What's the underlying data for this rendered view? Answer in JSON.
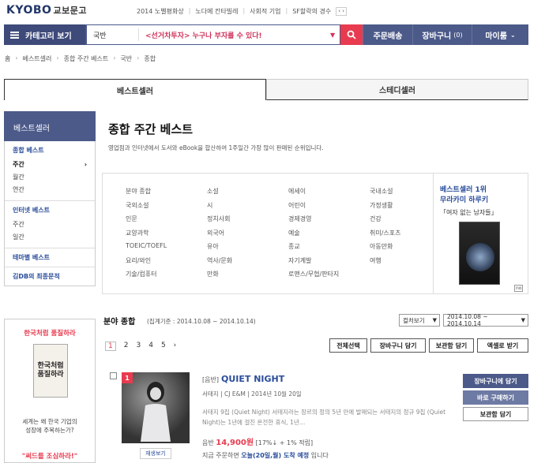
{
  "brand": {
    "logo_en": "KYOBO",
    "logo_kr": "교보문고"
  },
  "promo_links": [
    "2014 노벨평화상",
    "노다메 칸타빌레",
    "사회적 기업",
    "SF할락의 경수"
  ],
  "promo_arrows": "‹ ›",
  "nav": {
    "category_label": "카테고리 보기",
    "search_category": "국반",
    "search_placeholder": "<선거차투자> 누구나 부자를 수 있다!",
    "order_label": "주문배송",
    "cart_label": "장바구니",
    "cart_count": "(0)",
    "mypage_label": "마이룸"
  },
  "breadcrumb": [
    "홈",
    "베스트셀러",
    "종합 주간 베스트",
    "국반",
    "종합"
  ],
  "tabs": [
    "베스트셀러",
    "스테디셀러"
  ],
  "sidebar": {
    "head": "베스트셀러",
    "groups": [
      {
        "title": "종합 베스트",
        "items": [
          "주간",
          "월간",
          "연간"
        ]
      },
      {
        "title": "인터넷 베스트",
        "items": [
          "주간",
          "일간"
        ]
      },
      {
        "title": "테마별 베스트",
        "items": []
      },
      {
        "title": "김DB의 최종문적",
        "items": []
      }
    ]
  },
  "main": {
    "title": "종합 주간 베스트",
    "description": "영업점과 인터넷에서 도서와 eBook을 합산하여 1주일간 가장 많이 판매된 순위입니다.",
    "genres": [
      "분야 종합",
      "소설",
      "에세이",
      "국내소설",
      "국외소설",
      "시",
      "어린이",
      "가정생활",
      "인문",
      "정치사회",
      "경제경영",
      "건강",
      "교양과학",
      "외국어",
      "예술",
      "취미/스포츠",
      "TOEIC/TOEFL",
      "유아",
      "종교",
      "아동만화",
      "요리/와인",
      "역사/문화",
      "자기계발",
      "여행",
      "기술/컴퓨터",
      "만화",
      "로맨스/무협/판타지",
      ""
    ]
  },
  "banner": {
    "line1": "베스트셀러 1위",
    "line2": "무라카미 하루키",
    "line3": "「여자 없는 남자들」",
    "tag": "no"
  },
  "field": {
    "title": "분야 종합",
    "date": "(집계기준 : 2014.10.08 ~ 2014.10.14)",
    "sort": "컬처보기",
    "range": "2014.10.08 ~ 2014.10.14"
  },
  "pagination": [
    "1",
    "2",
    "3",
    "4",
    "5",
    "›"
  ],
  "actions": [
    "전체선택",
    "장바구니 담기",
    "보관함 담기",
    "엑셀로 받기"
  ],
  "product": {
    "rank": "1",
    "tag": "[음반]",
    "title": "QUIET NIGHT",
    "meta": "서태지 | CJ E&M | 2014년 10월 20일",
    "summary": "서태지 9집 (Quiet Night) 서태지라는 장르의 정의 5년 만에 발매되는 서태지의 정규 9집 (Quiet Night)는 1년에 걸친 온전한 휴식, 1년…",
    "price_label": "음반",
    "price": "14,900원",
    "discount": "[17%↓ + 1% 적립]",
    "delivery_prefix": "지금 주문하면",
    "delivery_date": "오늘(20일,월) 도착 예정",
    "delivery_suffix": "입니다",
    "preview": "재생보기",
    "btn_cart": "장바구니에 담기",
    "btn_buy": "바로 구매하기",
    "btn_keep": "보관함 담기"
  },
  "ad": {
    "headline": "한국처럼 품질하라",
    "book_title": "한국처럼\n품질하라",
    "body": "세계는 왜 한국 기업의\n성장에 주목하는가?",
    "footer": "\"써드를 조심하라!\""
  },
  "colors": {
    "navy": "#4c5a8a",
    "accent": "#e83b4f",
    "link": "#2a4d9b"
  }
}
